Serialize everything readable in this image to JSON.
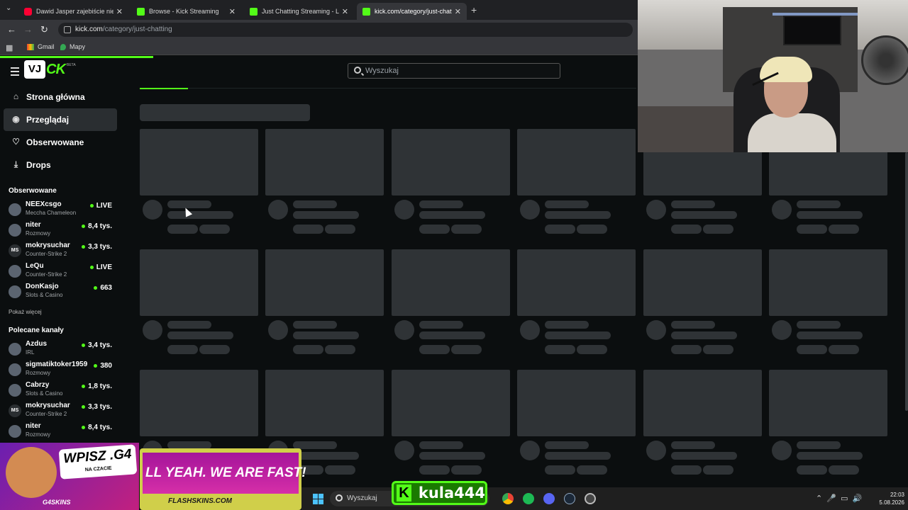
{
  "browser": {
    "tabs": [
      {
        "title": "Dawid Jasper zajebiście niesam",
        "favicon": "youtube-icon"
      },
      {
        "title": "Browse - Kick Streaming",
        "favicon": "kick-icon"
      },
      {
        "title": "Just Chatting Streaming - Live",
        "favicon": "kick-icon"
      },
      {
        "title": "kick.com/category/just-chatting",
        "favicon": "kick-icon",
        "active": true
      }
    ],
    "url_host": "kick.com",
    "url_path": "/category/just-chatting",
    "bookmarks": [
      {
        "label": "Gmail",
        "icon": "gmail-icon"
      },
      {
        "label": "Mapy",
        "icon": "maps-pin-icon"
      }
    ],
    "progress_fraction": 0.24
  },
  "kick": {
    "logo_left": "VJ",
    "logo_right": "CK",
    "logo_badge": "BETA",
    "search_placeholder": "Wyszukaj",
    "nav": [
      {
        "label": "Strona główna",
        "icon": "home-icon"
      },
      {
        "label": "Przeglądaj",
        "icon": "browse-icon",
        "selected": true
      },
      {
        "label": "Obserwowane",
        "icon": "heart-icon"
      },
      {
        "label": "Drops",
        "icon": "drops-icon"
      }
    ],
    "followed_title": "Obserwowane",
    "followed": [
      {
        "name": "NEEXcsgo",
        "category": "Meccha Chameleon",
        "viewers": "LIVE"
      },
      {
        "name": "niter",
        "category": "Rozmowy",
        "viewers": "8,4 tys."
      },
      {
        "name": "mokrysuchar",
        "category": "Counter-Strike 2",
        "viewers": "3,3 tys."
      },
      {
        "name": "LeQu",
        "category": "Counter-Strike 2",
        "viewers": "LIVE"
      },
      {
        "name": "DonKasjo",
        "category": "Slots & Casino",
        "viewers": "663"
      }
    ],
    "show_more": "Pokaż więcej",
    "recommended_title": "Polecane kanały",
    "recommended": [
      {
        "name": "Azdus",
        "category": "IRL",
        "viewers": "3,4 tys."
      },
      {
        "name": "sigmatiktoker1959",
        "category": "Rozmowy",
        "viewers": "380"
      },
      {
        "name": "Cabrzy",
        "category": "Slots & Casino",
        "viewers": "1,8 tys."
      },
      {
        "name": "mokrysuchar",
        "category": "Counter-Strike 2",
        "viewers": "3,3 tys."
      },
      {
        "name": "niter",
        "category": "Rozmowy",
        "viewers": "8,4 tys."
      }
    ],
    "avatar_initials": {
      "mokrysuchar": "MS"
    },
    "accent_color": "#53fc18",
    "skeleton_rows": 3,
    "skeleton_cols": 6
  },
  "overlay": {
    "ad_left_text": "WPISZ .G4",
    "ad_left_sub": "NA CZACIE",
    "ad_left_brand": "G4SKINS",
    "ad_right_text": "LL YEAH. WE ARE FAST!",
    "ad_right_brand": "FLASHSKINS.COM",
    "streamer_tag": "kula444"
  },
  "taskbar": {
    "search_placeholder": "Wyszukaj",
    "time": "22:03",
    "date": "5.08.2026"
  }
}
